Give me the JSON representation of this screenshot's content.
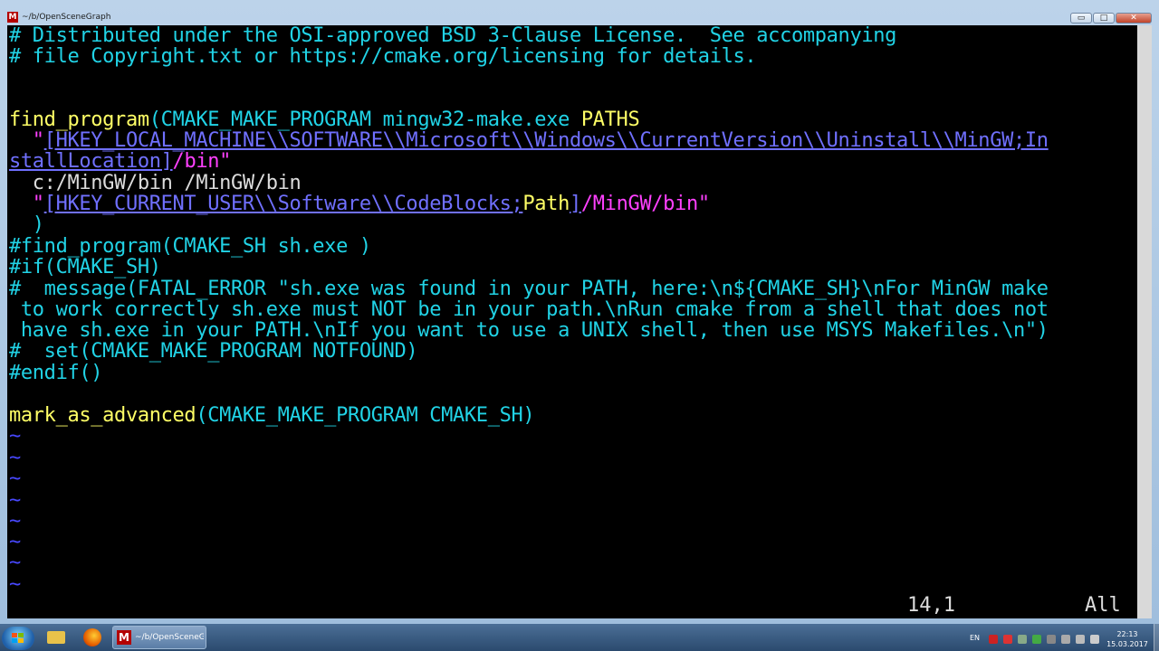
{
  "window": {
    "title": "~/b/OpenSceneGraph",
    "buttons": {
      "minimize": "▭",
      "maximize": "□",
      "close": "✕"
    }
  },
  "editor": {
    "l1": "# Distributed under the OSI-approved BSD 3-Clause License.  See accompanying",
    "l2": "# file Copyright.txt or https://cmake.org/licensing for details.",
    "l5a": "find_program",
    "l5b": "(CMAKE_MAKE_PROGRAM mingw32-make.exe ",
    "l5c": "PATHS",
    "l6a": "  \"",
    "l6b": "[HKEY_LOCAL_MACHINE\\\\SOFTWARE\\\\Microsoft\\\\Windows\\\\CurrentVersion\\\\Uninstall\\\\MinGW;In",
    "l7a": "stallLocation]",
    "l7b": "/bin\"",
    "l8": "  c:/MinGW/bin /MinGW/bin",
    "l9a": "  \"",
    "l9b": "[HKEY_CURRENT_USER\\\\Software\\\\CodeBlocks;",
    "l9c": "Path",
    "l9d": "]",
    "l9e": "/MinGW/bin\"",
    "l10": "  )",
    "l11": "#find_program(CMAKE_SH sh.exe )",
    "l12": "#if(CMAKE_SH)",
    "l13": "#  message(FATAL_ERROR \"sh.exe was found in your PATH, here:\\n${CMAKE_SH}\\nFor MinGW make",
    "l14": " to work correctly sh.exe must NOT be in your path.\\nRun cmake from a shell that does not",
    "l15": " have sh.exe in your PATH.\\nIf you want to use a UNIX shell, then use MSYS Makefiles.\\n\")",
    "l16": "#  set(CMAKE_MAKE_PROGRAM NOTFOUND)",
    "l17": "#endif()",
    "l19a": "mark_as_advanced",
    "l19b": "(CMAKE_MAKE_PROGRAM CMAKE_SH)",
    "tilde": "~",
    "position": "14,1",
    "scroll": "All"
  },
  "taskbar": {
    "vim_label": "~/b/OpenSceneG...",
    "lang": "EN",
    "time": "22:13",
    "date": "15.03.2017"
  },
  "colors": {
    "comment": "#21d3e6",
    "keyword": "#ffff66",
    "string": "#ff40ff",
    "link": "#7070ff",
    "tilde": "#4848ff"
  }
}
